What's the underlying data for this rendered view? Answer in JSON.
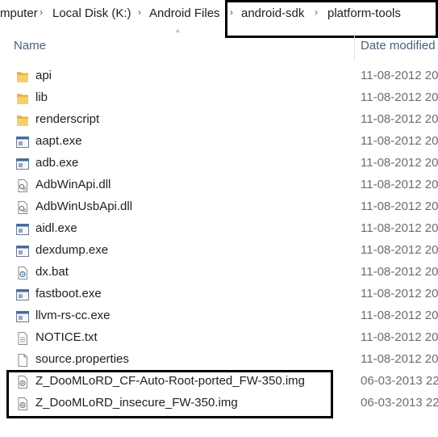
{
  "breadcrumb": {
    "items": [
      "mputer",
      "Local Disk (K:)",
      "Android Files",
      "android-sdk",
      "platform-tools"
    ],
    "separator_glyph": "›"
  },
  "columns": {
    "name": "Name",
    "date_modified": "Date modified",
    "sort_indicator": "^"
  },
  "colors": {
    "header_text": "#4c607a",
    "date_text": "#6d6d6d",
    "folder": "#e8b84a",
    "highlight_box": "#000000"
  },
  "files": [
    {
      "name": "api",
      "date": "11-08-2012 20",
      "icon": "folder-icon"
    },
    {
      "name": "lib",
      "date": "11-08-2012 20",
      "icon": "folder-icon"
    },
    {
      "name": "renderscript",
      "date": "11-08-2012 20",
      "icon": "folder-icon"
    },
    {
      "name": "aapt.exe",
      "date": "11-08-2012 20",
      "icon": "exe-icon"
    },
    {
      "name": "adb.exe",
      "date": "11-08-2012 20",
      "icon": "exe-icon"
    },
    {
      "name": "AdbWinApi.dll",
      "date": "11-08-2012 20",
      "icon": "dll-icon"
    },
    {
      "name": "AdbWinUsbApi.dll",
      "date": "11-08-2012 20",
      "icon": "dll-icon"
    },
    {
      "name": "aidl.exe",
      "date": "11-08-2012 20",
      "icon": "exe-icon"
    },
    {
      "name": "dexdump.exe",
      "date": "11-08-2012 20",
      "icon": "exe-icon"
    },
    {
      "name": "dx.bat",
      "date": "11-08-2012 20",
      "icon": "bat-icon"
    },
    {
      "name": "fastboot.exe",
      "date": "11-08-2012 20",
      "icon": "exe-icon"
    },
    {
      "name": "llvm-rs-cc.exe",
      "date": "11-08-2012 20",
      "icon": "exe-icon"
    },
    {
      "name": "NOTICE.txt",
      "date": "11-08-2012 20",
      "icon": "text-file-icon"
    },
    {
      "name": "source.properties",
      "date": "11-08-2012 20",
      "icon": "generic-file-icon"
    },
    {
      "name": "Z_DooMLoRD_CF-Auto-Root-ported_FW-350.img",
      "date": "06-03-2013 22",
      "icon": "img-file-icon"
    },
    {
      "name": "Z_DooMLoRD_insecure_FW-350.img",
      "date": "06-03-2013 22",
      "icon": "img-file-icon"
    }
  ]
}
